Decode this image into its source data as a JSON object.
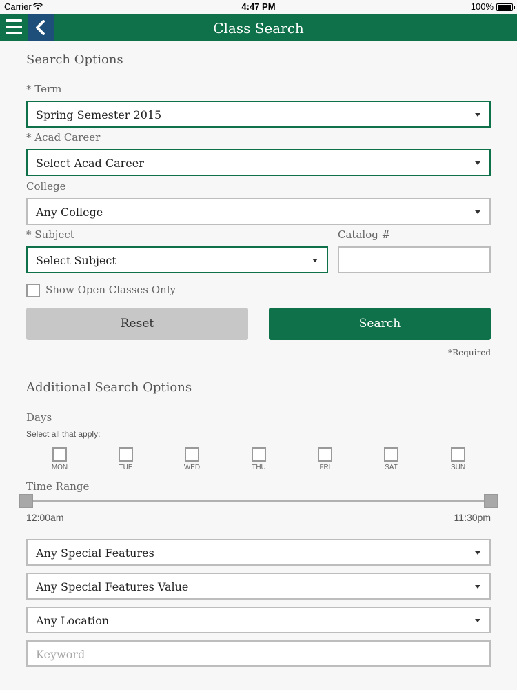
{
  "status_bar": {
    "carrier": "Carrier",
    "time": "4:47 PM",
    "battery": "100%"
  },
  "header": {
    "title": "Class Search"
  },
  "search_options": {
    "section_title": "Search Options",
    "term": {
      "label": "* Term",
      "value": "Spring Semester 2015"
    },
    "acad_career": {
      "label": "* Acad Career",
      "value": "Select Acad Career"
    },
    "college": {
      "label": "College",
      "value": "Any College"
    },
    "subject": {
      "label": "* Subject",
      "value": "Select Subject"
    },
    "catalog": {
      "label": "Catalog #",
      "value": ""
    },
    "open_only": {
      "label": "Show Open Classes Only",
      "checked": false
    },
    "reset_label": "Reset",
    "search_label": "Search",
    "required_note": "*Required"
  },
  "additional": {
    "section_title": "Additional Search Options",
    "days_label": "Days",
    "days_hint": "Select all that apply:",
    "days": [
      "MON",
      "TUE",
      "WED",
      "THU",
      "FRI",
      "SAT",
      "SUN"
    ],
    "time_range_label": "Time Range",
    "time_start": "12:00am",
    "time_end": "11:30pm",
    "special_features": "Any Special Features",
    "special_features_value": "Any Special Features Value",
    "location": "Any Location",
    "keyword_placeholder": "Keyword"
  },
  "icons": {
    "menu": "hamburger-menu-icon",
    "back": "chevron-left-icon",
    "wifi": "wifi-icon",
    "battery": "battery-icon"
  },
  "colors": {
    "primary": "#0e7149",
    "back_button": "#1d4f7a",
    "reset_button": "#c7c7c8"
  }
}
